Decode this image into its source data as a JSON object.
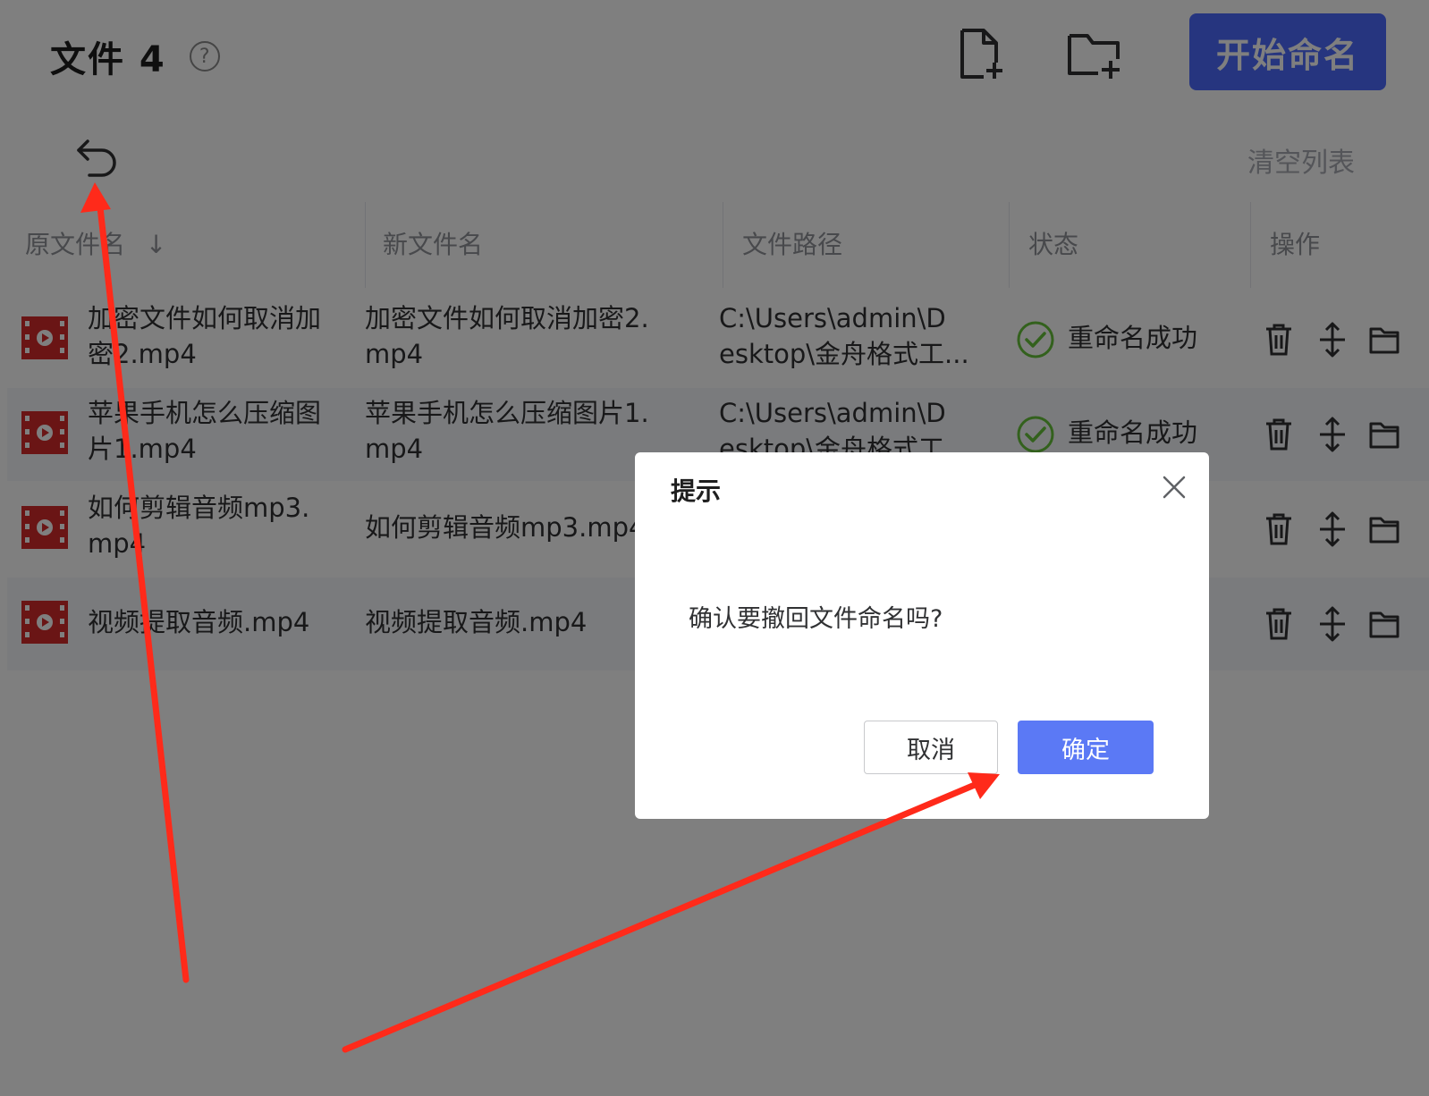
{
  "header": {
    "title": "文件 4",
    "help_icon": "question-circle-icon",
    "add_file_icon": "add-file-icon",
    "add_folder_icon": "add-folder-icon",
    "start_button": "开始命名",
    "accent_color": "#4d6bfe"
  },
  "toolbar": {
    "undo_icon": "undo-icon",
    "clear_list": "清空列表"
  },
  "table": {
    "columns": [
      "原文件名",
      "新文件名",
      "文件路径",
      "状态",
      "操作"
    ],
    "sort_icon": "arrow-down-icon",
    "rows": [
      {
        "original": [
          "加密文件如何取消加",
          "密2.mp4"
        ],
        "new_name": [
          "加密文件如何取消加密2.",
          "mp4"
        ],
        "path": [
          "C:\\Users\\admin\\D",
          "esktop\\金舟格式工..."
        ],
        "status": "重命名成功"
      },
      {
        "original": [
          "苹果手机怎么压缩图",
          "片1.mp4"
        ],
        "new_name": [
          "苹果手机怎么压缩图片1.",
          "mp4"
        ],
        "path": [
          "C:\\Users\\admin\\D",
          "esktop\\金舟格式工..."
        ],
        "status": "重命名成功"
      },
      {
        "original": [
          "如何剪辑音频mp3.",
          "mp4"
        ],
        "new_name": [
          "如何剪辑音频mp3.mp4"
        ],
        "path": [
          "",
          ""
        ],
        "status": ""
      },
      {
        "original": [
          "视频提取音频.mp4"
        ],
        "new_name": [
          "视频提取音频.mp4"
        ],
        "path": [
          "",
          ""
        ],
        "status": ""
      }
    ],
    "row_icons": {
      "file": "video-file-icon",
      "status": "check-circle-icon",
      "delete": "trash-icon",
      "move": "move-icon",
      "open": "folder-open-icon"
    },
    "success_color": "#67c23a"
  },
  "dialog": {
    "title": "提示",
    "message": "确认要撤回文件命名吗?",
    "cancel": "取消",
    "confirm": "确定",
    "close_icon": "close-icon"
  },
  "annotation_color": "#ff2a1a"
}
